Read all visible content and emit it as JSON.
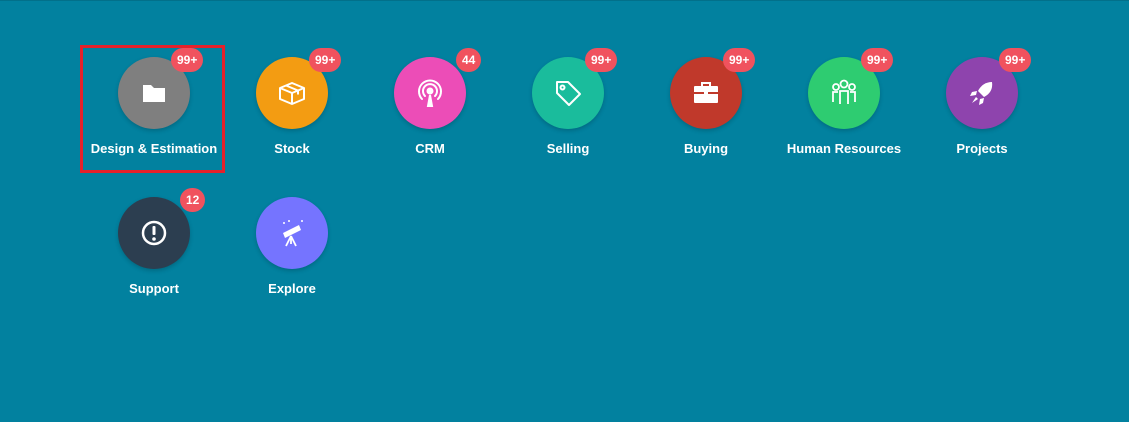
{
  "modules": [
    {
      "label": "Design & Estimation",
      "badge": "99+",
      "icon": "folder-icon",
      "color": "#7f7f7f"
    },
    {
      "label": "Stock",
      "badge": "99+",
      "icon": "box-icon",
      "color": "#f39c12"
    },
    {
      "label": "CRM",
      "badge": "44",
      "icon": "broadcast-icon",
      "color": "#ec4db7"
    },
    {
      "label": "Selling",
      "badge": "99+",
      "icon": "tag-icon",
      "color": "#1abc9c"
    },
    {
      "label": "Buying",
      "badge": "99+",
      "icon": "briefcase-icon",
      "color": "#c0392b"
    },
    {
      "label": "Human Resources",
      "badge": "99+",
      "icon": "users-icon",
      "color": "#2ecc71"
    },
    {
      "label": "Projects",
      "badge": "99+",
      "icon": "rocket-icon",
      "color": "#8e44ad"
    },
    {
      "label": "Support",
      "badge": "12",
      "icon": "alert-icon",
      "color": "#2c3e50"
    },
    {
      "label": "Explore",
      "badge": "",
      "icon": "telescope-icon",
      "color": "#7574ff"
    }
  ],
  "colors": {
    "background": "#02819f",
    "badge": "#f0525e",
    "highlight": "#e4212b"
  },
  "highlighted_module": "Design & Estimation"
}
